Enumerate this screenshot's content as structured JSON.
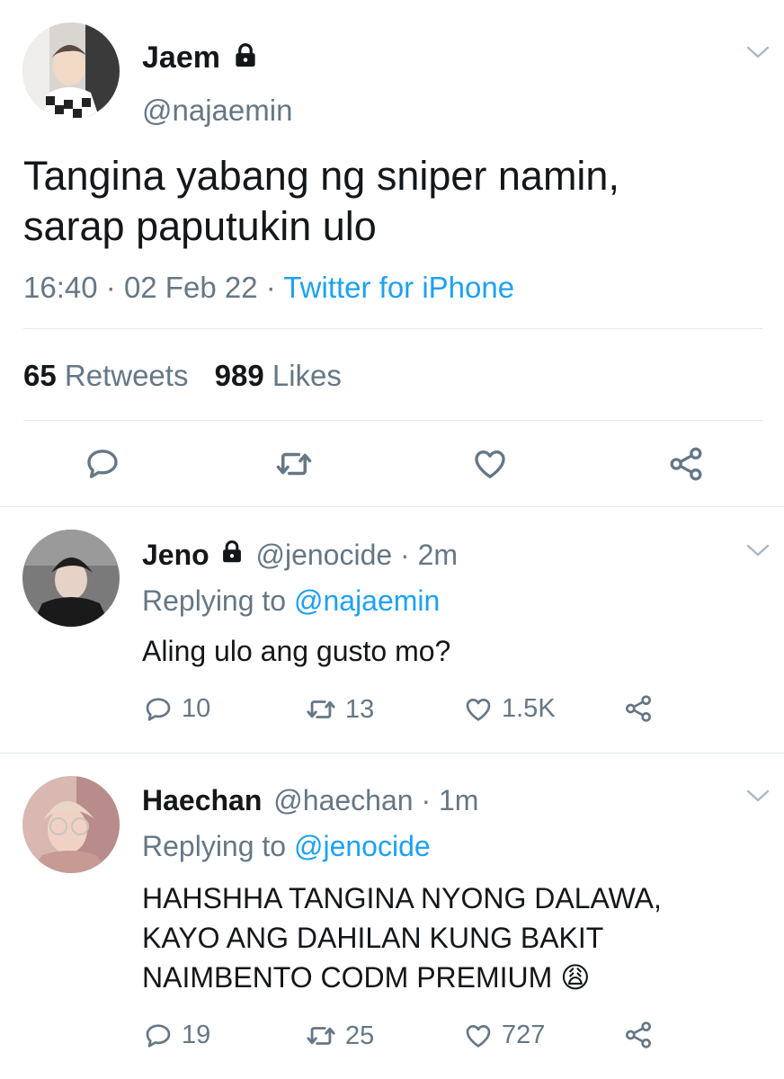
{
  "main_tweet": {
    "display_name": "Jaem",
    "handle": "@najaemin",
    "text_line1": "Tangina yabang ng sniper namin,",
    "text_line2": "sarap paputukin ulo",
    "time": "16:40",
    "date": "02 Feb 22",
    "source": "Twitter for iPhone",
    "retweets_count": "65",
    "retweets_label": "Retweets",
    "likes_count": "989",
    "likes_label": "Likes"
  },
  "replies": [
    {
      "display_name": "Jeno",
      "handle": "@jenocide",
      "age": "2m",
      "replying_label": "Replying to",
      "replying_to": "@najaemin",
      "text_line1": "Aling ulo ang gusto mo?",
      "replies_count": "10",
      "retweets_count": "13",
      "likes_count": "1.5K"
    },
    {
      "display_name": "Haechan",
      "handle": "@haechan",
      "age": "1m",
      "replying_label": "Replying to",
      "replying_to": "@jenocide",
      "text_line1": "HAHSHHA TANGINA NYONG DALAWA,",
      "text_line2": "KAYO ANG DAHILAN KUNG BAKIT",
      "text_line3": "NAIMBENTO CODM PREMIUM",
      "emoji": "😩",
      "replies_count": "19",
      "retweets_count": "25",
      "likes_count": "727"
    }
  ],
  "separator": "·",
  "colors": {
    "link": "#1da1f2",
    "muted": "#657786",
    "text": "#14171a",
    "divider": "#e1e8ed"
  },
  "icons": [
    "lock-icon",
    "chevron-down-icon",
    "reply-icon",
    "retweet-icon",
    "like-icon",
    "share-icon"
  ]
}
